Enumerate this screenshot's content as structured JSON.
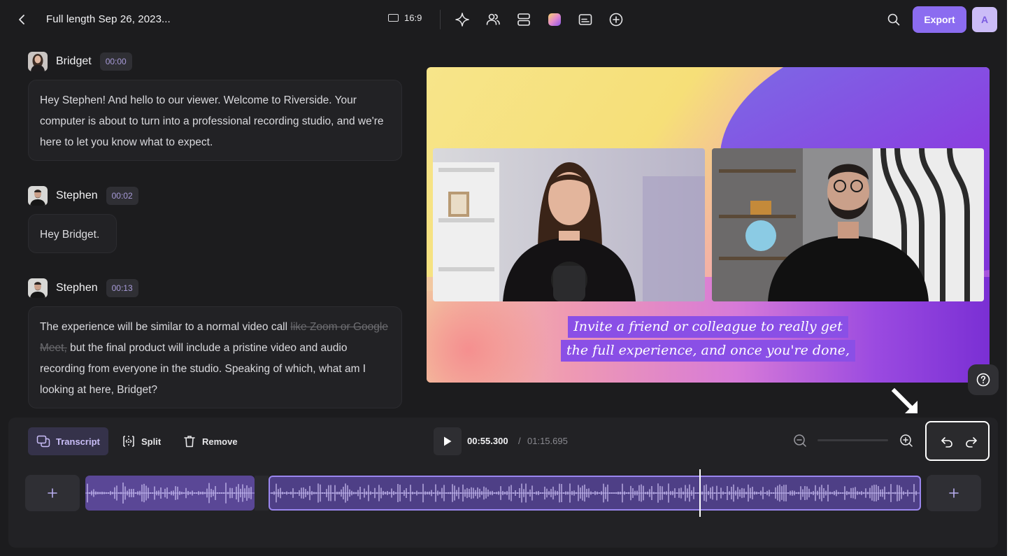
{
  "header": {
    "title": "Full length Sep 26, 2023...",
    "aspect_ratio": "16:9",
    "tool_icons": [
      "sparkle-icon",
      "speakers-icon",
      "layout-icon",
      "brand-kit-icon",
      "captions-icon",
      "add-icon"
    ],
    "export_label": "Export",
    "avatar_initial": "A"
  },
  "transcript": [
    {
      "speaker": "Bridget",
      "time": "00:00",
      "text": "Hey Stephen! And hello to our viewer. Welcome to Riverside. Your computer is about to turn into a professional recording studio, and we're here to let you know what to expect."
    },
    {
      "speaker": "Stephen",
      "time": "00:02",
      "text": "Hey Bridget."
    },
    {
      "speaker": "Stephen",
      "time": "00:13",
      "text_before": "The experience will be similar to a normal video call ",
      "text_removed": "like Zoom or Google Meet,",
      "text_after": " but the final product will include a pristine video and audio recording from everyone in the studio. Speaking of which, what am I looking at here, Bridget?"
    }
  ],
  "preview": {
    "caption_line1": "Invite a friend or colleague to really get",
    "caption_line2": "the full experience, and once you're done,"
  },
  "toolbar": {
    "transcript_label": "Transcript",
    "split_label": "Split",
    "remove_label": "Remove",
    "current_time": "00:55.300",
    "separator": "/",
    "total_time": "01:15.695"
  },
  "colors": {
    "accent": "#8b6cf0",
    "background": "#1c1c1e",
    "panel": "#222225",
    "clip_selected_border": "#9a86ee"
  }
}
